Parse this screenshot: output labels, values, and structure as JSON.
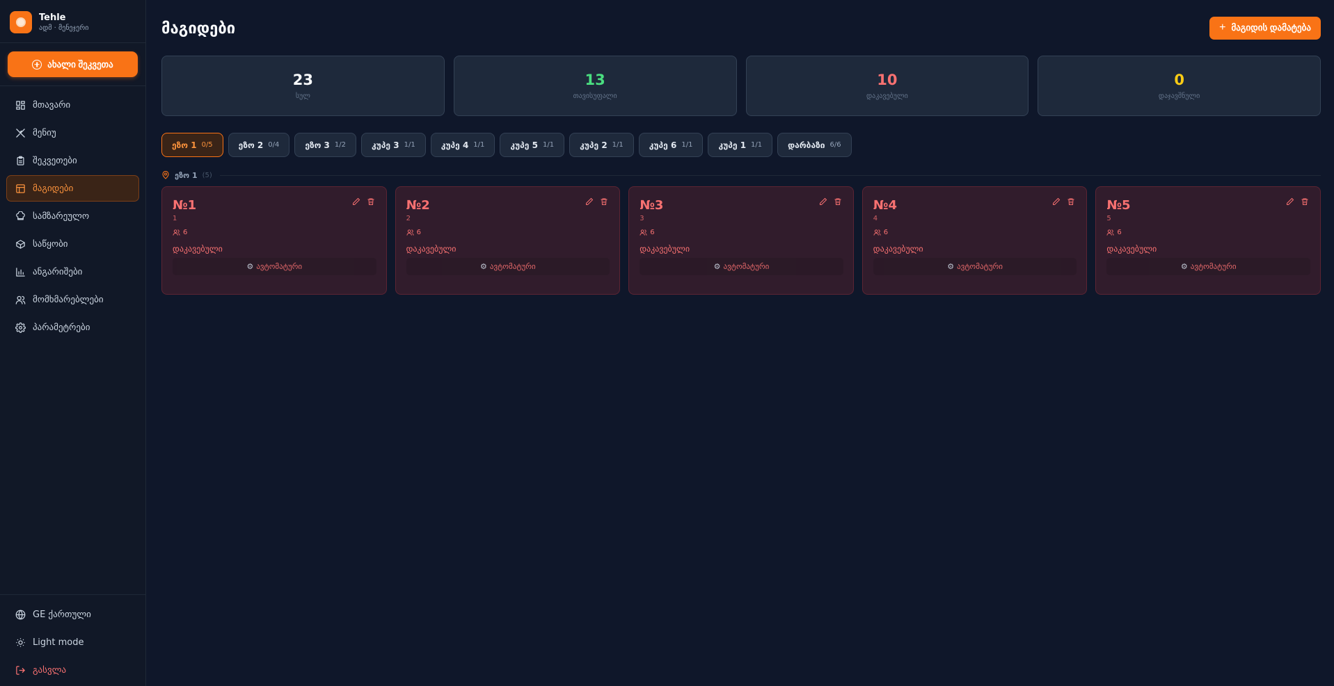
{
  "brand": {
    "name": "Tehle",
    "subtitle": "ადმ · მენეჯერი"
  },
  "sidebar": {
    "new_order_label": "ახალი შეკვეთა",
    "items": [
      {
        "label": "მთავარი",
        "icon": "dashboard-icon",
        "active": false
      },
      {
        "label": "მენიუ",
        "icon": "utensils-icon",
        "active": false
      },
      {
        "label": "შეკვეთები",
        "icon": "clipboard-icon",
        "active": false
      },
      {
        "label": "მაგიდები",
        "icon": "table-icon",
        "active": true
      },
      {
        "label": "სამზარეულო",
        "icon": "chef-hat-icon",
        "active": false
      },
      {
        "label": "საწყობი",
        "icon": "box-icon",
        "active": false
      },
      {
        "label": "ანგარიშები",
        "icon": "chart-icon",
        "active": false
      },
      {
        "label": "მომხმარებლები",
        "icon": "users-icon",
        "active": false
      },
      {
        "label": "პარამეტრები",
        "icon": "gear-icon",
        "active": false
      }
    ],
    "bottom": {
      "language": "GE ქართული",
      "theme": "Light mode",
      "logout": "გასვლა"
    }
  },
  "header": {
    "title": "მაგიდები",
    "add_button_label": "მაგიდის დამატება"
  },
  "stats": [
    {
      "value": "23",
      "label": "სულ",
      "color": "#f8fafc"
    },
    {
      "value": "13",
      "label": "თავისუფალი",
      "color": "#4ade80"
    },
    {
      "value": "10",
      "label": "დაკავებული",
      "color": "#f87171"
    },
    {
      "value": "0",
      "label": "დაჯავშნული",
      "color": "#facc15"
    }
  ],
  "tabs": [
    {
      "label": "ეზო 1",
      "count": "0/5",
      "active": true
    },
    {
      "label": "ეზო 2",
      "count": "0/4",
      "active": false
    },
    {
      "label": "ეზო 3",
      "count": "1/2",
      "active": false
    },
    {
      "label": "კუპე 3",
      "count": "1/1",
      "active": false
    },
    {
      "label": "კუპე 4",
      "count": "1/1",
      "active": false
    },
    {
      "label": "კუპე 5",
      "count": "1/1",
      "active": false
    },
    {
      "label": "კუპე 2",
      "count": "1/1",
      "active": false
    },
    {
      "label": "კუპე 6",
      "count": "1/1",
      "active": false
    },
    {
      "label": "კუპე 1",
      "count": "1/1",
      "active": false
    },
    {
      "label": "დარბაზი",
      "count": "6/6",
      "active": false
    }
  ],
  "section": {
    "name": "ეზო 1",
    "count": "(5)"
  },
  "tables": [
    {
      "name": "№1",
      "sub": "1",
      "seats": "6",
      "status": "დაკავებული",
      "auto": "ავტომატური"
    },
    {
      "name": "№2",
      "sub": "2",
      "seats": "6",
      "status": "დაკავებული",
      "auto": "ავტომატური"
    },
    {
      "name": "№3",
      "sub": "3",
      "seats": "6",
      "status": "დაკავებული",
      "auto": "ავტომატური"
    },
    {
      "name": "№4",
      "sub": "4",
      "seats": "6",
      "status": "დაკავებული",
      "auto": "ავტომატური"
    },
    {
      "name": "№5",
      "sub": "5",
      "seats": "6",
      "status": "დაკავებული",
      "auto": "ავტომატური"
    }
  ]
}
